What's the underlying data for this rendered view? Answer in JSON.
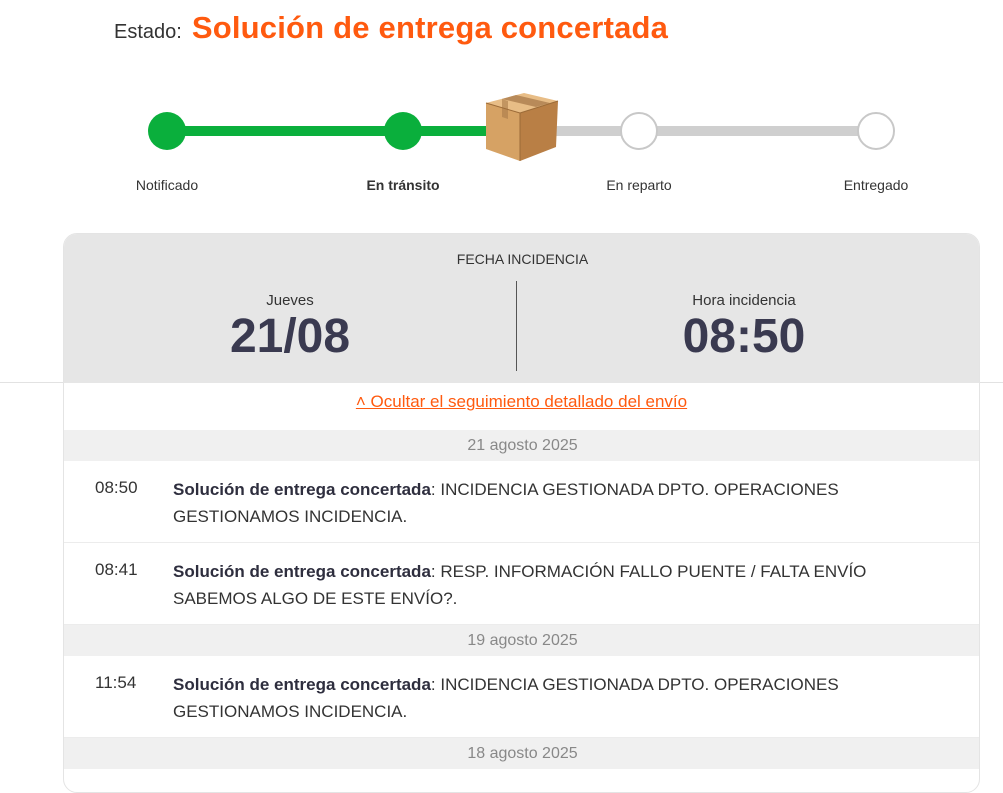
{
  "status": {
    "label": "Estado:",
    "value": "Solución de entrega concertada"
  },
  "colors": {
    "accent": "#ff5a0f",
    "progress_done": "#0aaf3c",
    "progress_todo": "#cfcfcf"
  },
  "tracker": {
    "steps": [
      {
        "label": "Notificado",
        "state": "done"
      },
      {
        "label": "En tránsito",
        "state": "current"
      },
      {
        "label": "En reparto",
        "state": "pending"
      },
      {
        "label": "Entregado",
        "state": "pending"
      }
    ],
    "current_icon": "package-box-icon"
  },
  "incident": {
    "title": "FECHA INCIDENCIA",
    "day_label": "Jueves",
    "date": "21/08",
    "time_label": "Hora incidencia",
    "time": "08:50"
  },
  "toggle_link": "˄ Ocultar el seguimiento detallado del envío",
  "history": [
    {
      "date": "21 agosto 2025",
      "events": [
        {
          "time": "08:50",
          "status": "Solución de entrega concertada",
          "detail": ": INCIDENCIA GESTIONADA DPTO. OPERACIONES GESTIONAMOS INCIDENCIA."
        },
        {
          "time": "08:41",
          "status": "Solución de entrega concertada",
          "detail": ": RESP. INFORMACIÓN FALLO PUENTE / FALTA ENVÍO SABEMOS ALGO DE ESTE ENVÍO?."
        }
      ]
    },
    {
      "date": "19 agosto 2025",
      "events": [
        {
          "time": "11:54",
          "status": "Solución de entrega concertada",
          "detail": ": INCIDENCIA GESTIONADA DPTO. OPERACIONES GESTIONAMOS INCIDENCIA."
        }
      ]
    },
    {
      "date": "18 agosto 2025",
      "events": []
    }
  ]
}
